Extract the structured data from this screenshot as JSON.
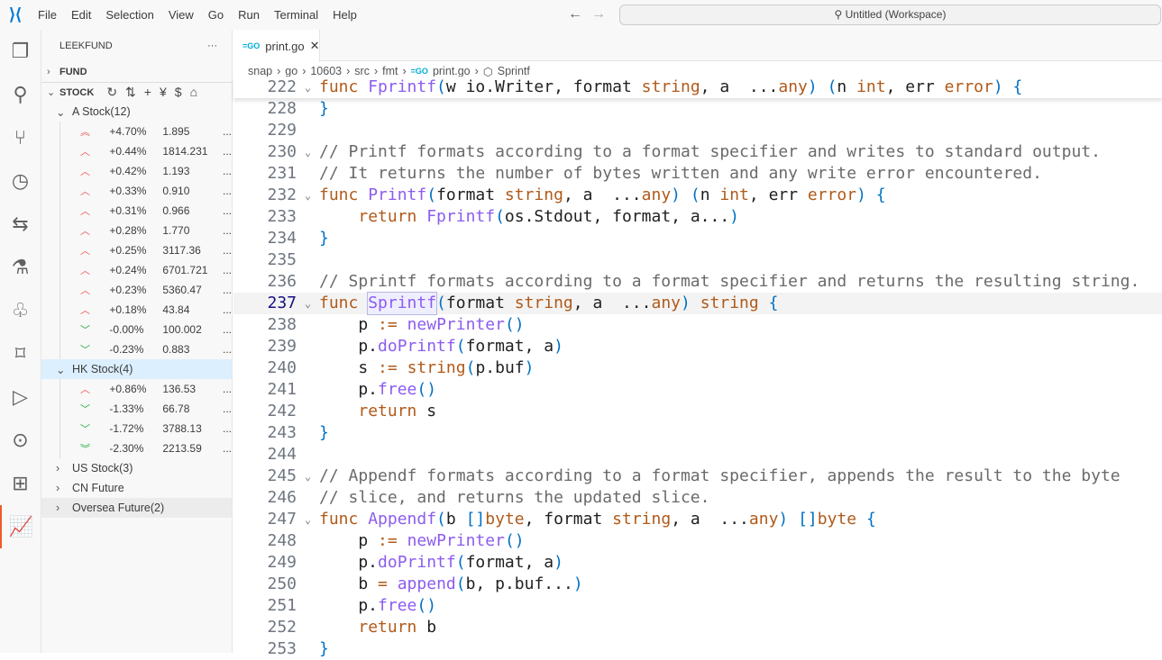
{
  "titlebar": {
    "menus": [
      "File",
      "Edit",
      "Selection",
      "View",
      "Go",
      "Run",
      "Terminal",
      "Help"
    ],
    "search": "Untitled (Workspace)"
  },
  "sidebar": {
    "title": "LEEKFUND",
    "more": "···",
    "fund": "FUND",
    "stock": "STOCK",
    "groups": [
      {
        "label": "A Stock(12)",
        "expanded": true,
        "rows": [
          {
            "dir": "up2",
            "pct": "+4.70%",
            "price": "1.895"
          },
          {
            "dir": "up",
            "pct": "+0.44%",
            "price": "1814.231"
          },
          {
            "dir": "up",
            "pct": "+0.42%",
            "price": "1.193"
          },
          {
            "dir": "up",
            "pct": "+0.33%",
            "price": "0.910"
          },
          {
            "dir": "up",
            "pct": "+0.31%",
            "price": "0.966"
          },
          {
            "dir": "up",
            "pct": "+0.28%",
            "price": "1.770"
          },
          {
            "dir": "up",
            "pct": "+0.25%",
            "price": "3117.36"
          },
          {
            "dir": "up",
            "pct": "+0.24%",
            "price": "6701.721"
          },
          {
            "dir": "up",
            "pct": "+0.23%",
            "price": "5360.47"
          },
          {
            "dir": "up",
            "pct": "+0.18%",
            "price": "43.84"
          },
          {
            "dir": "down",
            "pct": "-0.00%",
            "price": "100.002"
          },
          {
            "dir": "down",
            "pct": "-0.23%",
            "price": "0.883"
          }
        ]
      },
      {
        "label": "HK Stock(4)",
        "expanded": true,
        "selected": true,
        "rows": [
          {
            "dir": "up",
            "pct": "+0.86%",
            "price": "136.53"
          },
          {
            "dir": "down",
            "pct": "-1.33%",
            "price": "66.78"
          },
          {
            "dir": "down",
            "pct": "-1.72%",
            "price": "3788.13"
          },
          {
            "dir": "down2",
            "pct": "-2.30%",
            "price": "2213.59"
          }
        ]
      },
      {
        "label": "US Stock(3)",
        "expanded": false,
        "rows": []
      },
      {
        "label": "CN Future",
        "expanded": false,
        "rows": []
      },
      {
        "label": "Oversea Future(2)",
        "expanded": false,
        "hover": true,
        "rows": []
      }
    ],
    "row_more": "..."
  },
  "editor": {
    "tab": "print.go",
    "breadcrumbs": [
      "snap",
      "go",
      "10603",
      "src",
      "fmt",
      "print.go",
      "Sprintf"
    ],
    "lines": [
      {
        "num": "222",
        "fold": true,
        "sticky": true,
        "tokens": [
          [
            "k",
            "func "
          ],
          [
            "f",
            "Fprintf"
          ],
          [
            "p",
            "("
          ],
          [
            "n",
            "w io.Writer, format "
          ],
          [
            "t",
            "string"
          ],
          [
            "n",
            ", a  ..."
          ],
          [
            "t",
            "any"
          ],
          [
            "p",
            ") ("
          ],
          [
            "n",
            "n "
          ],
          [
            "t",
            "int"
          ],
          [
            "n",
            ", err "
          ],
          [
            "t",
            "error"
          ],
          [
            "p",
            ")"
          ],
          [
            "n",
            " "
          ],
          [
            "p",
            "{"
          ]
        ]
      },
      {
        "num": "228",
        "tokens": [
          [
            "p",
            "}"
          ]
        ]
      },
      {
        "num": "229",
        "tokens": []
      },
      {
        "num": "230",
        "fold": true,
        "tokens": [
          [
            "c",
            "// Printf formats according to a format specifier and writes to standard output."
          ]
        ]
      },
      {
        "num": "231",
        "tokens": [
          [
            "c",
            "// It returns the number of bytes written and any write error encountered."
          ]
        ]
      },
      {
        "num": "232",
        "fold": true,
        "tokens": [
          [
            "k",
            "func "
          ],
          [
            "f",
            "Printf"
          ],
          [
            "p",
            "("
          ],
          [
            "n",
            "format "
          ],
          [
            "t",
            "string"
          ],
          [
            "n",
            ", a  ..."
          ],
          [
            "t",
            "any"
          ],
          [
            "p",
            ") ("
          ],
          [
            "n",
            "n "
          ],
          [
            "t",
            "int"
          ],
          [
            "n",
            ", err "
          ],
          [
            "t",
            "error"
          ],
          [
            "p",
            ")"
          ],
          [
            "n",
            " "
          ],
          [
            "p",
            "{"
          ]
        ]
      },
      {
        "num": "233",
        "tokens": [
          [
            "n",
            "    "
          ],
          [
            "k",
            "return "
          ],
          [
            "f",
            "Fprintf"
          ],
          [
            "p",
            "("
          ],
          [
            "n",
            "os.Stdout, format, a..."
          ],
          [
            "p",
            ")"
          ]
        ]
      },
      {
        "num": "234",
        "tokens": [
          [
            "p",
            "}"
          ]
        ]
      },
      {
        "num": "235",
        "tokens": []
      },
      {
        "num": "236",
        "tokens": [
          [
            "c",
            "// Sprintf formats according to a format specifier and returns the resulting string."
          ]
        ]
      },
      {
        "num": "237",
        "fold": true,
        "current": true,
        "tokens": [
          [
            "k",
            "func "
          ],
          [
            "f hl",
            "Sprintf"
          ],
          [
            "p",
            "("
          ],
          [
            "n",
            "format "
          ],
          [
            "t",
            "string"
          ],
          [
            "n",
            ", a  ..."
          ],
          [
            "t",
            "any"
          ],
          [
            "p",
            ")"
          ],
          [
            "n",
            " "
          ],
          [
            "t",
            "string"
          ],
          [
            "n",
            " "
          ],
          [
            "p",
            "{"
          ]
        ]
      },
      {
        "num": "238",
        "tokens": [
          [
            "n",
            "    p "
          ],
          [
            "o",
            ":="
          ],
          [
            "n",
            " "
          ],
          [
            "f",
            "newPrinter"
          ],
          [
            "p",
            "()"
          ]
        ]
      },
      {
        "num": "239",
        "tokens": [
          [
            "n",
            "    p."
          ],
          [
            "f",
            "doPrintf"
          ],
          [
            "p",
            "("
          ],
          [
            "n",
            "format, a"
          ],
          [
            "p",
            ")"
          ]
        ]
      },
      {
        "num": "240",
        "tokens": [
          [
            "n",
            "    s "
          ],
          [
            "o",
            ":="
          ],
          [
            "n",
            " "
          ],
          [
            "t",
            "string"
          ],
          [
            "p",
            "("
          ],
          [
            "n",
            "p.buf"
          ],
          [
            "p",
            ")"
          ]
        ]
      },
      {
        "num": "241",
        "tokens": [
          [
            "n",
            "    p."
          ],
          [
            "f",
            "free"
          ],
          [
            "p",
            "()"
          ]
        ]
      },
      {
        "num": "242",
        "tokens": [
          [
            "n",
            "    "
          ],
          [
            "k",
            "return"
          ],
          [
            "n",
            " s"
          ]
        ]
      },
      {
        "num": "243",
        "tokens": [
          [
            "p",
            "}"
          ]
        ]
      },
      {
        "num": "244",
        "tokens": []
      },
      {
        "num": "245",
        "fold": true,
        "tokens": [
          [
            "c",
            "// Appendf formats according to a format specifier, appends the result to the byte"
          ]
        ]
      },
      {
        "num": "246",
        "tokens": [
          [
            "c",
            "// slice, and returns the updated slice."
          ]
        ]
      },
      {
        "num": "247",
        "fold": true,
        "tokens": [
          [
            "k",
            "func "
          ],
          [
            "f",
            "Appendf"
          ],
          [
            "p",
            "("
          ],
          [
            "n",
            "b "
          ],
          [
            "p",
            "[]"
          ],
          [
            "t",
            "byte"
          ],
          [
            "n",
            ", format "
          ],
          [
            "t",
            "string"
          ],
          [
            "n",
            ", a  ..."
          ],
          [
            "t",
            "any"
          ],
          [
            "p",
            ") []"
          ],
          [
            "t",
            "byte"
          ],
          [
            "n",
            " "
          ],
          [
            "p",
            "{"
          ]
        ]
      },
      {
        "num": "248",
        "tokens": [
          [
            "n",
            "    p "
          ],
          [
            "o",
            ":="
          ],
          [
            "n",
            " "
          ],
          [
            "f",
            "newPrinter"
          ],
          [
            "p",
            "()"
          ]
        ]
      },
      {
        "num": "249",
        "tokens": [
          [
            "n",
            "    p."
          ],
          [
            "f",
            "doPrintf"
          ],
          [
            "p",
            "("
          ],
          [
            "n",
            "format, a"
          ],
          [
            "p",
            ")"
          ]
        ]
      },
      {
        "num": "250",
        "tokens": [
          [
            "n",
            "    b "
          ],
          [
            "o",
            "="
          ],
          [
            "n",
            " "
          ],
          [
            "f",
            "append"
          ],
          [
            "p",
            "("
          ],
          [
            "n",
            "b, p.buf..."
          ],
          [
            "p",
            ")"
          ]
        ]
      },
      {
        "num": "251",
        "tokens": [
          [
            "n",
            "    p."
          ],
          [
            "f",
            "free"
          ],
          [
            "p",
            "()"
          ]
        ]
      },
      {
        "num": "252",
        "tokens": [
          [
            "n",
            "    "
          ],
          [
            "k",
            "return"
          ],
          [
            "n",
            " b"
          ]
        ]
      },
      {
        "num": "253",
        "tokens": [
          [
            "p",
            "}"
          ]
        ]
      }
    ]
  }
}
